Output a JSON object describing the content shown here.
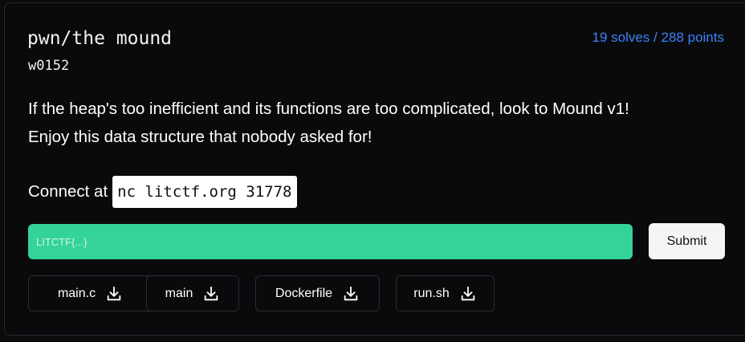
{
  "challenge": {
    "title": "pwn/the mound",
    "author": "w0152",
    "stats": "19 solves / 288 points",
    "description": [
      "If the heap's too inefficient and its functions are too complicated, look to Mound v1!",
      "Enjoy this data structure that nobody asked for!"
    ],
    "connect_label": "Connect at",
    "connect_command": "nc litctf.org 31778"
  },
  "flag_form": {
    "placeholder": "LITCTF{...}",
    "value": "",
    "submit_label": "Submit"
  },
  "files": [
    {
      "name": "main.c",
      "icon": "download-icon"
    },
    {
      "name": "main",
      "icon": "download-icon"
    },
    {
      "name": "Dockerfile",
      "icon": "download-icon"
    },
    {
      "name": "run.sh",
      "icon": "download-icon"
    }
  ],
  "colors": {
    "background": "#0a0a0d",
    "accent_blue": "#3b82f6",
    "flag_input": "#34d399",
    "text": "#ffffff"
  }
}
